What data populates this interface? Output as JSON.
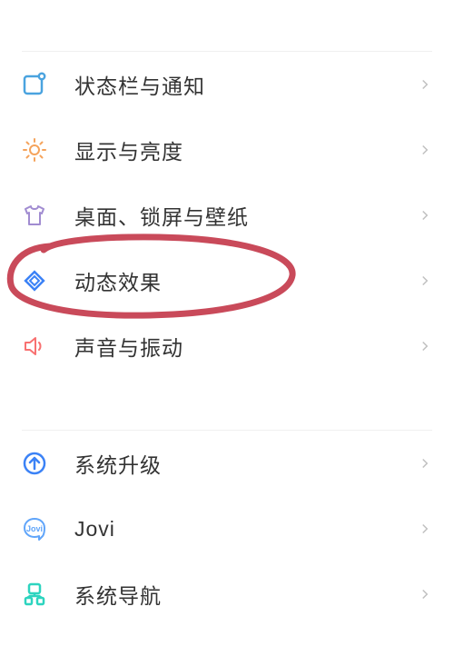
{
  "settings": {
    "group1": [
      {
        "id": "status-bar-notification",
        "label": "状态栏与通知",
        "icon": "status-bar-icon",
        "color": "#4aa3df"
      },
      {
        "id": "display-brightness",
        "label": "显示与亮度",
        "icon": "brightness-icon",
        "color": "#f5a35b"
      },
      {
        "id": "desktop-lock-wallpaper",
        "label": "桌面、锁屏与壁纸",
        "icon": "tshirt-icon",
        "color": "#a18cd1"
      },
      {
        "id": "motion-effects",
        "label": "动态效果",
        "icon": "diamond-icon",
        "color": "#3b82f6"
      },
      {
        "id": "sound-vibration",
        "label": "声音与振动",
        "icon": "speaker-icon",
        "color": "#f87171"
      }
    ],
    "group2": [
      {
        "id": "system-update",
        "label": "系统升级",
        "icon": "update-icon",
        "color": "#3b82f6"
      },
      {
        "id": "jovi",
        "label": "Jovi",
        "icon": "jovi-icon",
        "color": "#60a5fa"
      },
      {
        "id": "system-navigation",
        "label": "系统导航",
        "icon": "navigation-icon",
        "color": "#2dd4bf"
      }
    ]
  },
  "annotation": {
    "highlighted_item": "desktop-lock-wallpaper"
  }
}
